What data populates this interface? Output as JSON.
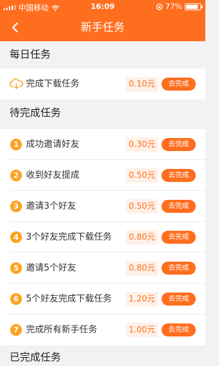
{
  "status_bar": {
    "carrier": "中国移动",
    "time": "16:09",
    "battery": "77%"
  },
  "navbar": {
    "title": "新手任务"
  },
  "sections": {
    "daily": "每日任务",
    "pending": "待完成任务",
    "completed": "已完成任务"
  },
  "daily_tasks": [
    {
      "icon": "download-cloud-icon",
      "label": "完成下载任务",
      "reward": "0.10元",
      "action": "去完成"
    }
  ],
  "pending_tasks": [
    {
      "num": "1",
      "label": "成功邀请好友",
      "reward": "0.30元",
      "action": "去完成"
    },
    {
      "num": "2",
      "label": "收到好友提成",
      "reward": "0.50元",
      "action": "去完成"
    },
    {
      "num": "3",
      "label": "邀请3个好友",
      "reward": "0.50元",
      "action": "去完成"
    },
    {
      "num": "4",
      "label": "3个好友完成下载任务",
      "reward": "0.80元",
      "action": "去完成"
    },
    {
      "num": "5",
      "label": "邀请5个好友",
      "reward": "0.80元",
      "action": "去完成"
    },
    {
      "num": "6",
      "label": "5个好友完成下载任务",
      "reward": "1.20元",
      "action": "去完成"
    },
    {
      "num": "7",
      "label": "完成所有新手任务",
      "reward": "1.00元",
      "action": "去完成"
    }
  ],
  "colors": {
    "accent": "#ff6e1f",
    "number_badge": "#ffa21f",
    "reward_bg": "#fff1e8"
  }
}
